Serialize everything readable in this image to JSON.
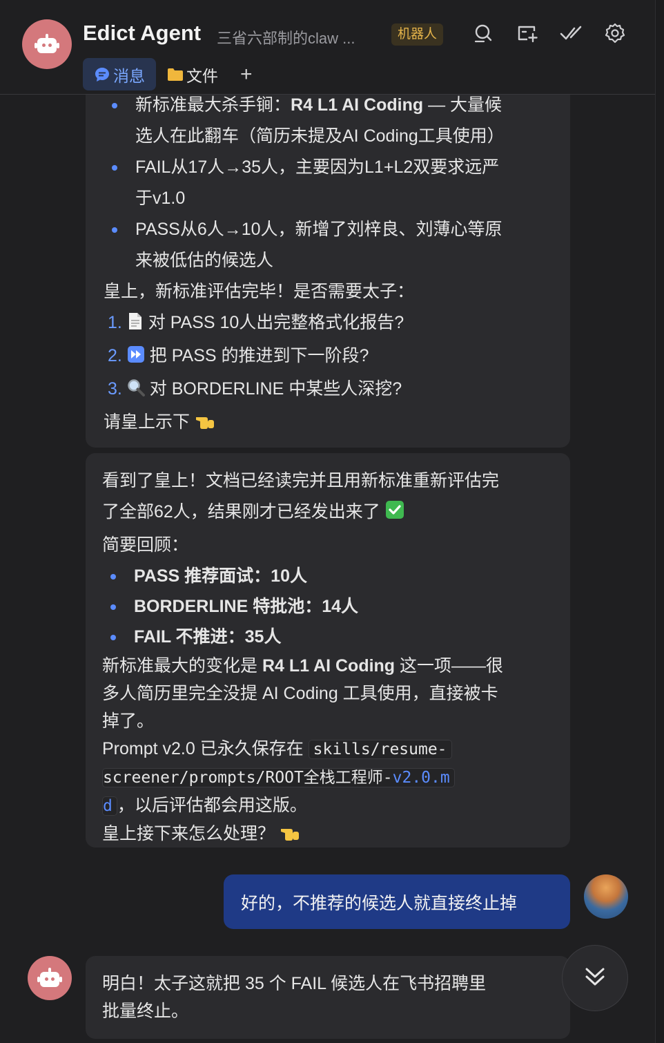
{
  "header": {
    "title": "Edict Agent",
    "subtitle": "三省六部制的claw ...",
    "badge": "机器人",
    "icons": [
      "search-icon",
      "add-screen-icon",
      "check-all-icon",
      "gear-icon"
    ]
  },
  "tabs": [
    {
      "label": "消息",
      "active": true,
      "icon": "chat-bubble-icon"
    },
    {
      "label": "文件",
      "active": false,
      "icon": "folder-icon"
    }
  ],
  "tab_add": "+",
  "msg1": {
    "bullet1_a_prefix": "新标准最大杀手锏：",
    "bullet1_a_bold": "R4 L1 AI Coding",
    "bullet1_a_suffix": " — 大量候",
    "bullet1_b": "选人在此翻车（简历未提及AI Coding工具使用）",
    "bullet2_a": "FAIL从17人→35人，主要因为L1+L2双要求远严",
    "bullet2_b": "于v1.0",
    "bullet3_a": "PASS从6人→10人，新增了刘梓良、刘薄心等原",
    "bullet3_b": "来被低估的候选人",
    "line_ask": "皇上，新标准评估完毕！是否需要太子：",
    "opt1_num": "1.",
    "opt1_text": "对 PASS 10人出完整格式化报告?",
    "opt2_num": "2.",
    "opt2_text": "把 PASS 的推进到下一阶段?",
    "opt3_num": "3.",
    "opt3_text": "对 BORDERLINE 中某些人深挖?",
    "closing": "请皇上示下"
  },
  "msg2": {
    "line1": "看到了皇上！文档已经读完并且用新标准重新评估完",
    "line2": "了全部62人，结果刚才已经发出来了",
    "line3": "简要回顾：",
    "b1": "PASS 推荐面试：10人",
    "b2": "BORDERLINE 特批池：14人",
    "b3": "FAIL 不推进：35人",
    "line4_prefix": "新标准最大的变化是 ",
    "line4_bold": "R4 L1 AI Coding",
    "line4_suffix": " 这一项——很",
    "line5": "多人简历里完全没提 AI Coding 工具使用，直接被卡",
    "line6": "掉了。",
    "line7_prefix": "Prompt v2.0 已永久保存在 ",
    "code1": "skills/resume-",
    "code2_a": "screener/prompts/ROOT全栈工程师-",
    "code2_b": "v2.0.m",
    "code3": "d",
    "line9_suffix": "，以后评估都会用这版。",
    "line10": "皇上接下来怎么处理？"
  },
  "user_msg": "好的，不推荐的候选人就直接终止掉",
  "msg3": {
    "line1": "明白！太子这就把 35 个 FAIL 候选人在飞书招聘里",
    "line2": "批量终止。"
  },
  "colors": {
    "accent": "#5b8cff",
    "user_bubble": "#1f3a86",
    "bot_avatar": "#d4787c",
    "badge_text": "#e4b34a"
  }
}
